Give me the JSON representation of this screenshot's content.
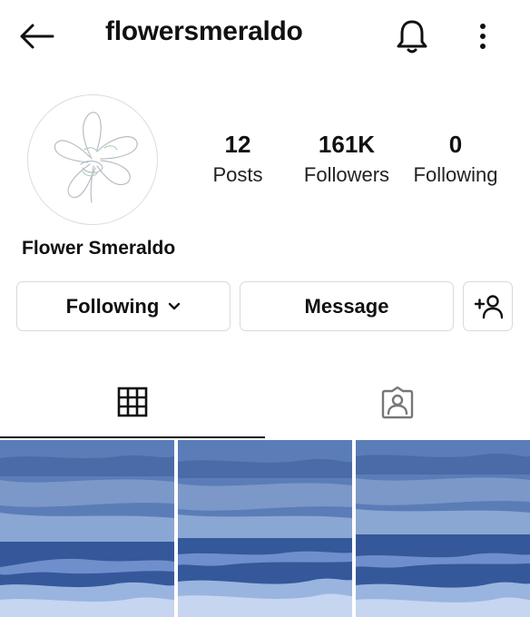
{
  "header": {
    "username": "flowersmeraldo",
    "back_icon": "arrow-left-icon",
    "notify_icon": "bell-icon",
    "more_icon": "more-vertical-icon"
  },
  "profile": {
    "avatar_icon": "flower-sketch",
    "display_name": "Flower Smeraldo",
    "stats": [
      {
        "value": "12",
        "label": "Posts"
      },
      {
        "value": "161K",
        "label": "Followers"
      },
      {
        "value": "0",
        "label": "Following"
      }
    ]
  },
  "actions": {
    "following_label": "Following",
    "message_label": "Message",
    "add_icon": "add-person-icon"
  },
  "tabs": [
    {
      "icon": "grid-icon",
      "active": true
    },
    {
      "icon": "tagged-person-icon",
      "active": false
    }
  ],
  "posts": [
    {
      "subject": "ocean waves under blue sky"
    },
    {
      "subject": "ocean waves under blue sky"
    },
    {
      "subject": "ocean waves under blue sky"
    }
  ],
  "colors": {
    "text": "#111111",
    "border": "#d9d9d9",
    "sky": "#5b7fb9",
    "sea": "#3b5f9f"
  }
}
